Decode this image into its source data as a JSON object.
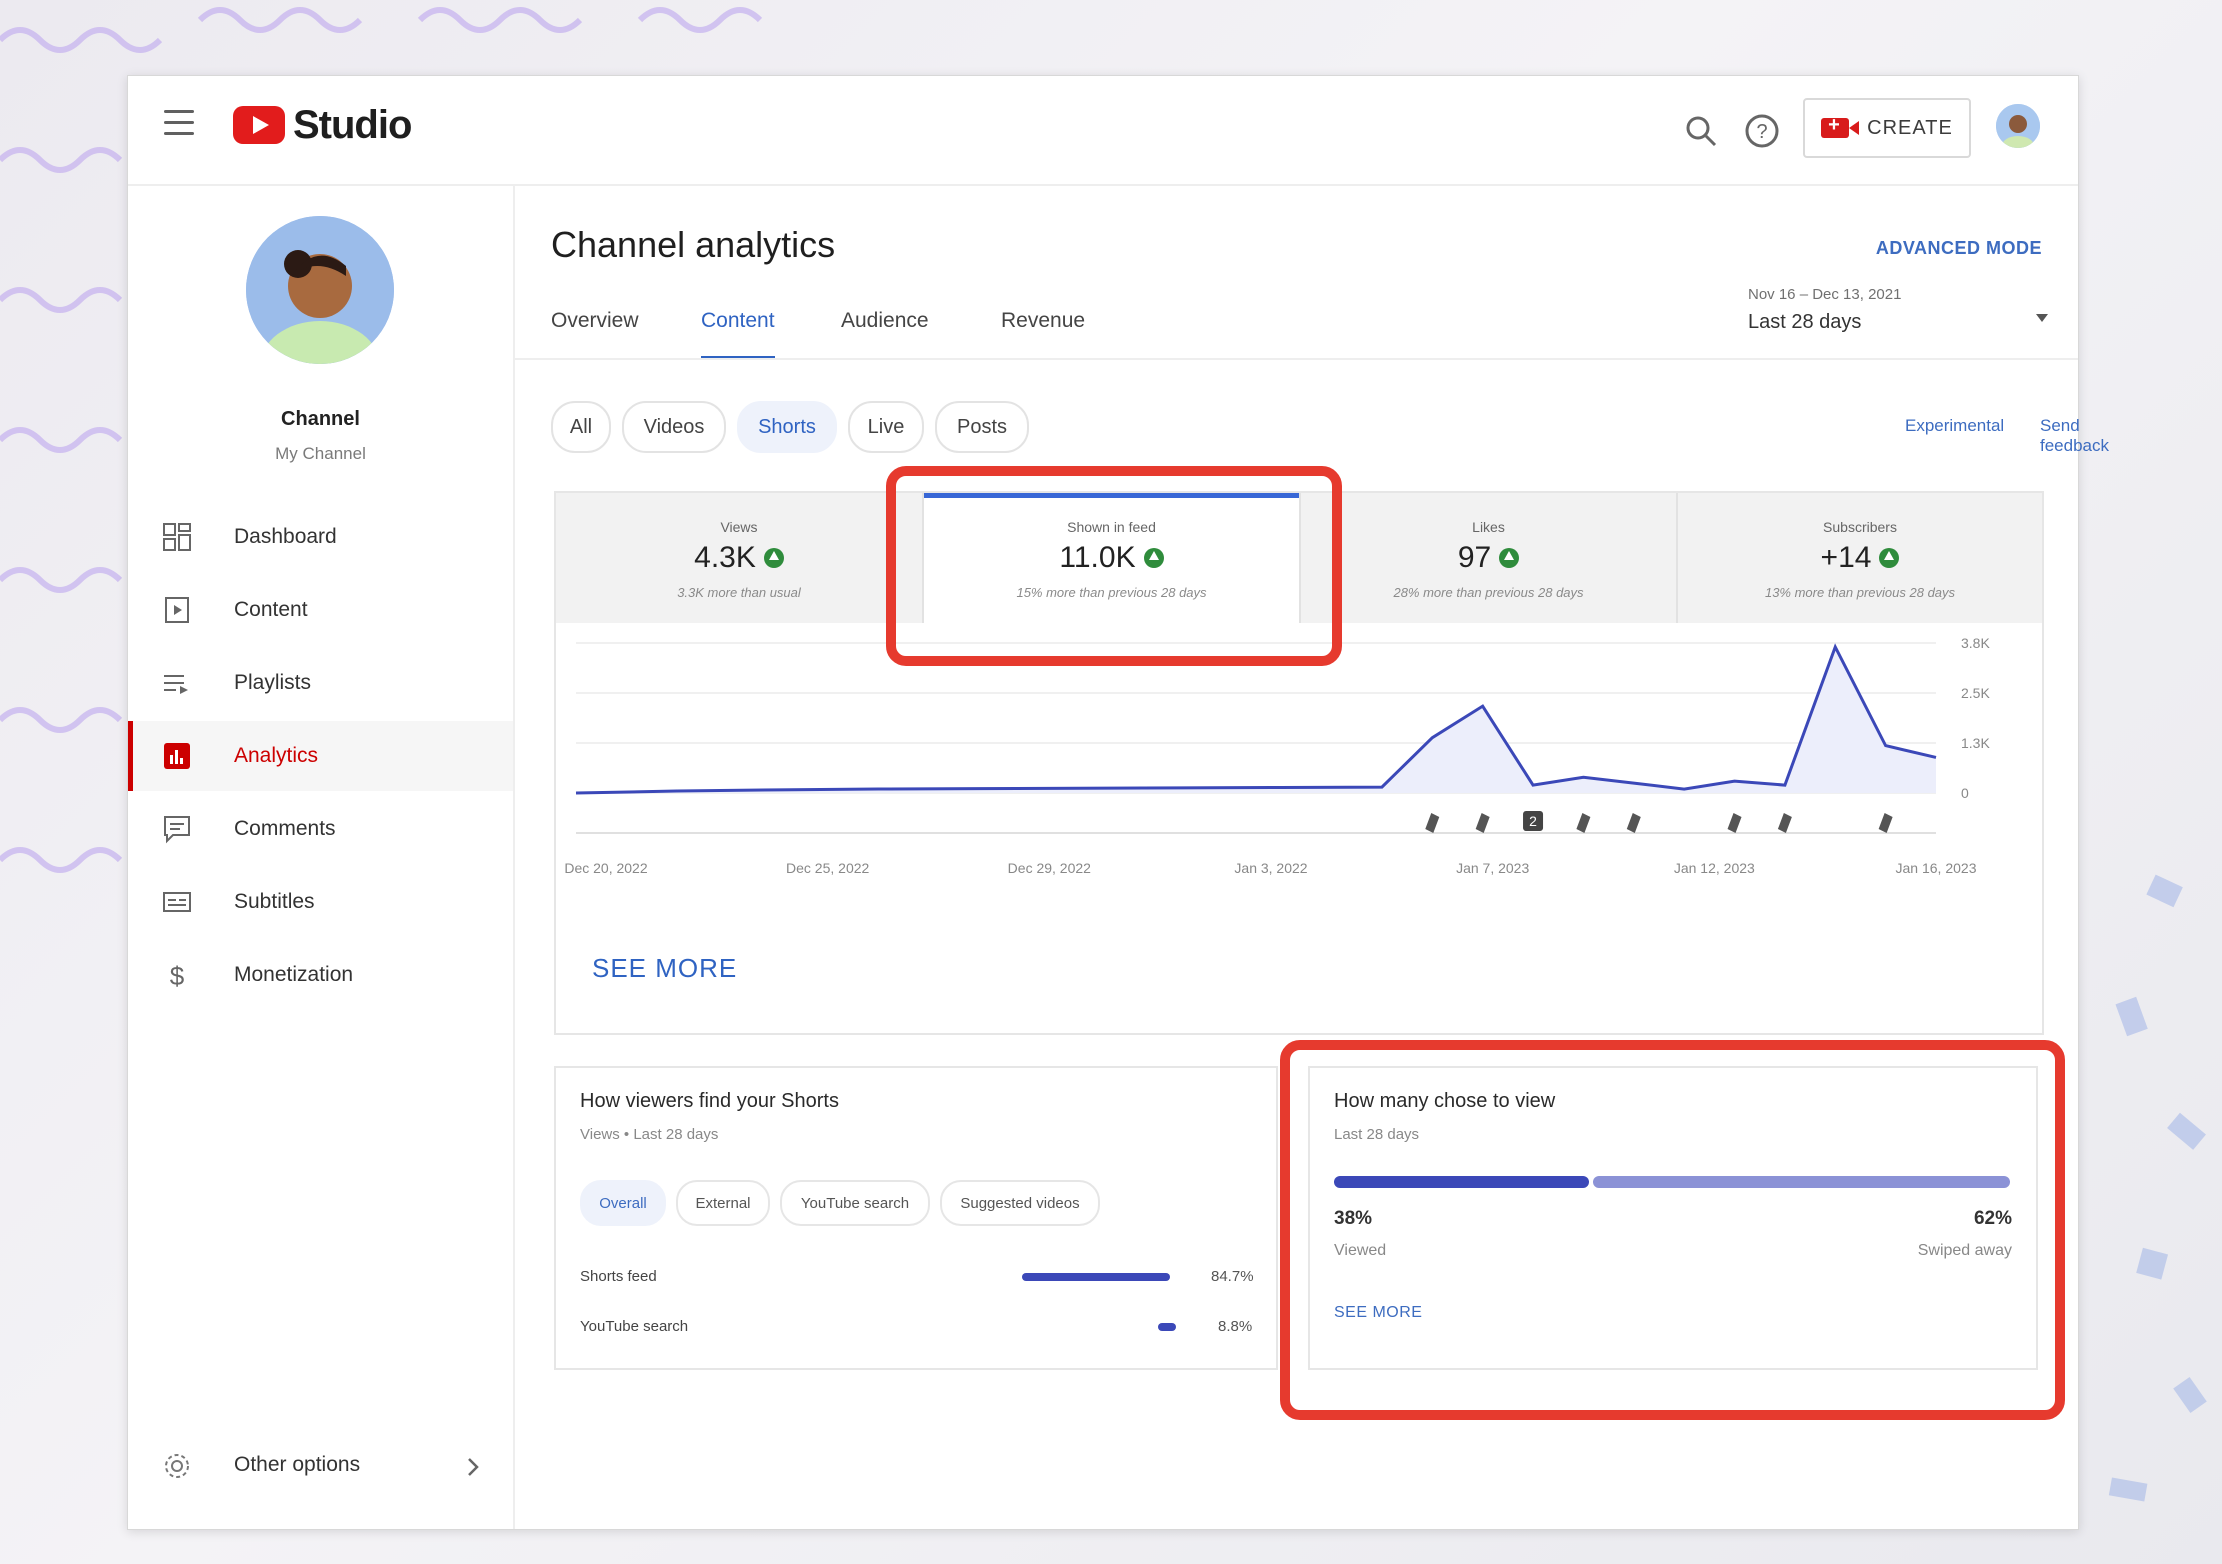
{
  "app": {
    "title": "Studio"
  },
  "colors": {
    "brand": "#e21c1c",
    "accent": "#2f63c2",
    "highlight": "#e63a2e",
    "series": "#3b48b8"
  },
  "channel": {
    "name": "Channel",
    "subtitle": "My Channel"
  },
  "sidebar": {
    "items": [
      {
        "label": "Dashboard",
        "icon": "dashboard-icon"
      },
      {
        "label": "Content",
        "icon": "content-icon"
      },
      {
        "label": "Playlists",
        "icon": "playlists-icon"
      },
      {
        "label": "Analytics",
        "icon": "analytics-icon",
        "active": true
      },
      {
        "label": "Comments",
        "icon": "comments-icon"
      },
      {
        "label": "Subtitles",
        "icon": "subtitles-icon"
      },
      {
        "label": "Monetization",
        "icon": "dollar-icon"
      }
    ],
    "other_options": "Other options"
  },
  "header": {
    "create_label": "CREATE"
  },
  "page": {
    "title": "Channel analytics",
    "advanced_mode": "ADVANCED MODE",
    "tabs": [
      "Overview",
      "Content",
      "Audience",
      "Revenue"
    ],
    "active_tab": "Content",
    "date_range": {
      "dates": "Nov 16 – Dec 13, 2021",
      "label": "Last 28 days"
    },
    "chips": [
      "All",
      "Videos",
      "Shorts",
      "Live",
      "Posts"
    ],
    "active_chip": "Shorts",
    "experimental": "Experimental",
    "send_feedback": "Send feedback"
  },
  "metrics": [
    {
      "label": "Views",
      "value": "4.3K",
      "sub": "3.3K more than usual"
    },
    {
      "label": "Shown in feed",
      "value": "11.0K",
      "sub": "15% more than previous 28 days",
      "selected": true
    },
    {
      "label": "Likes",
      "value": "97",
      "sub": "28% more than previous 28 days"
    },
    {
      "label": "Subscribers",
      "value": "+14",
      "sub": "13% more than previous 28 days"
    }
  ],
  "chart_data": {
    "type": "area",
    "x_tick_labels": [
      "Dec 20, 2022",
      "Dec 25, 2022",
      "Dec 29, 2022",
      "Jan 3, 2022",
      "Jan 7, 2023",
      "Jan 12, 2023",
      "Jan 16, 2023"
    ],
    "y_tick_labels": [
      "3.8K",
      "2.5K",
      "1.3K",
      "0"
    ],
    "ylim": [
      0,
      3800
    ],
    "x": [
      0,
      2,
      4,
      6,
      8,
      10,
      12,
      14,
      16,
      17,
      18,
      19,
      20,
      21,
      22,
      23,
      24,
      25,
      26,
      27
    ],
    "values": [
      0,
      50,
      80,
      100,
      110,
      120,
      130,
      140,
      150,
      1400,
      2200,
      200,
      400,
      250,
      100,
      300,
      200,
      3700,
      1200,
      900
    ],
    "grid": true,
    "marker_label": "2"
  },
  "see_more_chart": "SEE MORE",
  "find_shorts": {
    "title": "How viewers find your Shorts",
    "subtitle": "Views • Last 28 days",
    "chips": [
      "Overall",
      "External",
      "YouTube search",
      "Suggested videos"
    ],
    "active_chip": "Overall",
    "rows": [
      {
        "label": "Shorts feed",
        "value": "84.7%",
        "fraction": 0.847
      },
      {
        "label": "YouTube search",
        "value": "8.8%",
        "fraction": 0.088
      }
    ]
  },
  "chose_to_view": {
    "title": "How many chose to view",
    "subtitle": "Last 28 days",
    "viewed_pct": "38%",
    "viewed_label": "Viewed",
    "swiped_pct": "62%",
    "swiped_label": "Swiped away",
    "viewed_fraction": 0.38,
    "see_more": "SEE MORE"
  }
}
